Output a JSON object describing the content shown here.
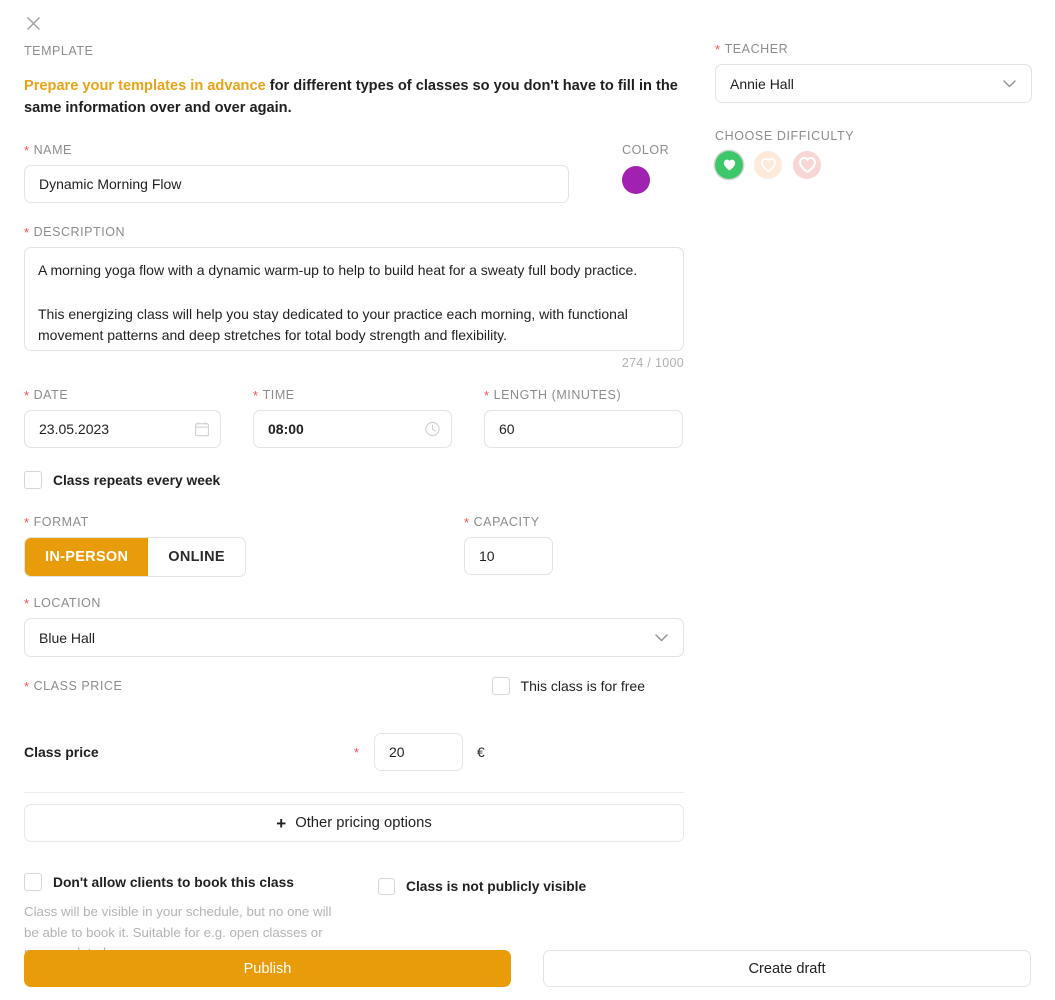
{
  "close_icon": "close-icon",
  "template": {
    "section_label": "TEMPLATE",
    "blurb_highlight": "Prepare your templates in advance",
    "blurb_rest": " for different types of classes so you don't have to fill in the same information over and over again.",
    "highlight_color": "#e8a317"
  },
  "name": {
    "label": "NAME",
    "value": "Dynamic Morning Flow",
    "required": true
  },
  "color": {
    "label": "COLOR",
    "value": "#a020b0"
  },
  "description": {
    "label": "DESCRIPTION",
    "required": true,
    "paragraph_1": "A morning yoga flow with a dynamic warm-up to help to build heat for a sweaty full body practice.",
    "paragraph_2": "This energizing class will help you stay dedicated to your practice each morning, with functional movement patterns and deep stretches for total body strength and flexibility.",
    "counter": "274 / 1000",
    "char_count": 274,
    "char_max": 1000
  },
  "date": {
    "label": "DATE",
    "value": "23.05.2023",
    "icon": "calendar-icon",
    "required": true
  },
  "time": {
    "label": "TIME",
    "value": "08:00",
    "icon": "clock-icon",
    "required": true
  },
  "length": {
    "label": "LENGTH (MINUTES)",
    "value": "60",
    "required": true
  },
  "repeat": {
    "label": "Class repeats every week",
    "checked": false
  },
  "format": {
    "label": "FORMAT",
    "required": true,
    "options": [
      "IN-PERSON",
      "ONLINE"
    ],
    "selected": "IN-PERSON",
    "active_color": "#e89c0a"
  },
  "capacity": {
    "label": "CAPACITY",
    "value": "10",
    "required": true
  },
  "location": {
    "label": "LOCATION",
    "value": "Blue Hall",
    "icon": "chevron-down-icon",
    "required": true
  },
  "price": {
    "section_label": "CLASS PRICE",
    "required": true,
    "free_checkbox_label": "This class is for free",
    "free_checked": false,
    "row_label": "Class price",
    "value": "20",
    "currency": "€",
    "other_pricing_label": "Other pricing options",
    "plus_icon": "plus-icon"
  },
  "booking": {
    "no_booking_label": "Don't allow clients to book this class",
    "no_booking_checked": false,
    "not_public_label": "Class is not publicly visible",
    "not_public_checked": false,
    "helper_text": "Class will be visible in your schedule, but no one will be able to book it. Suitable for e.g. open classes or pre-populated courses."
  },
  "footer": {
    "publish_label": "Publish",
    "draft_label": "Create draft",
    "publish_color": "#e89c0a"
  },
  "teacher": {
    "label": "TEACHER",
    "value": "Annie Hall",
    "icon": "chevron-down-icon",
    "required": true
  },
  "difficulty": {
    "label": "CHOOSE DIFFICULTY",
    "levels": [
      {
        "name": "easy",
        "color": "#3cc86a",
        "selected": true
      },
      {
        "name": "medium",
        "color": "#fdeadb",
        "selected": false
      },
      {
        "name": "hard",
        "color": "#f9d6d6",
        "selected": false
      }
    ]
  }
}
